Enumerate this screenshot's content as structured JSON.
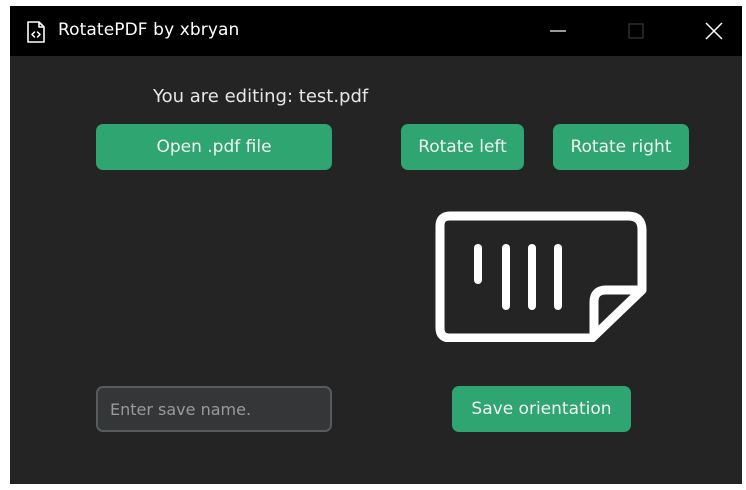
{
  "window": {
    "title": "RotatePDF by xbryan"
  },
  "main": {
    "editing_text": "You are editing: test.pdf",
    "open_button": "Open .pdf file",
    "rotate_left_button": "Rotate left",
    "rotate_right_button": "Rotate right",
    "save_name_input": {
      "value": "",
      "placeholder": "Enter save name."
    },
    "save_button": "Save orientation"
  },
  "icons": {
    "app": "pdf-file-icon",
    "minimize": "minimize-icon",
    "maximize": "maximize-icon",
    "close": "close-icon",
    "preview": "document-page-icon"
  },
  "colors": {
    "accent": "#2fa572",
    "background": "#242424",
    "titlebar": "#000000"
  }
}
